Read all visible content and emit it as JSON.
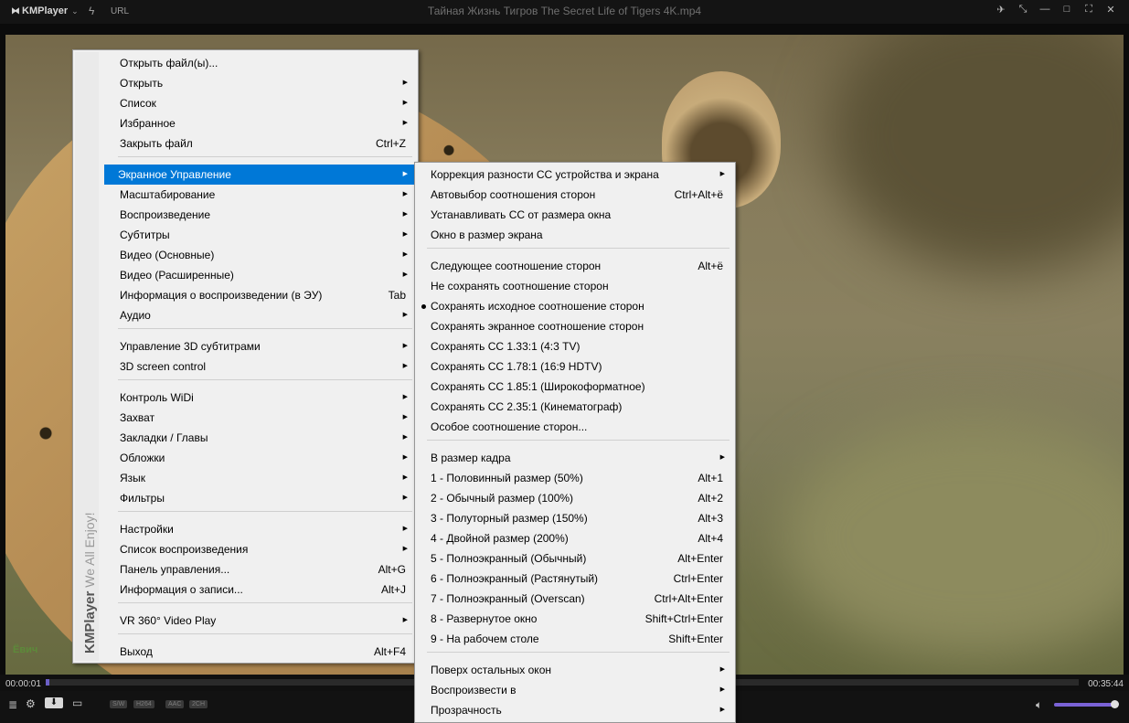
{
  "titlebar": {
    "brand": "KMPlayer",
    "url_label": "URL",
    "title": "Тайная Жизнь Тигров   The Secret Life of Tigers   4K.mp4"
  },
  "video": {
    "corner_text": "Ёвич"
  },
  "player": {
    "time_current": "00:00:01",
    "time_total": "00:35:44",
    "progress_fraction": 0.002,
    "volume_fraction": 0.95,
    "tags": [
      "S/W",
      "H264",
      "AAC",
      "2CH"
    ]
  },
  "main_menu": {
    "brand_strip": "KMPlayer",
    "brand_tagline": "We All Enjoy!",
    "items": [
      {
        "label": "Открыть файл(ы)...",
        "shortcut": "",
        "sub": false
      },
      {
        "label": "Открыть",
        "shortcut": "",
        "sub": true
      },
      {
        "label": "Список",
        "shortcut": "",
        "sub": true
      },
      {
        "label": "Избранное",
        "shortcut": "",
        "sub": true
      },
      {
        "label": "Закрыть файл",
        "shortcut": "Ctrl+Z",
        "sub": false
      },
      {
        "label": "Экранное Управление",
        "shortcut": "",
        "sub": true
      },
      {
        "label": "Масштабирование",
        "shortcut": "",
        "sub": true
      },
      {
        "label": "Воспроизведение",
        "shortcut": "",
        "sub": true
      },
      {
        "label": "Субтитры",
        "shortcut": "",
        "sub": true
      },
      {
        "label": "Видео (Основные)",
        "shortcut": "",
        "sub": true
      },
      {
        "label": "Видео (Расширенные)",
        "shortcut": "",
        "sub": true
      },
      {
        "label": "Информация о воспроизведении (в ЭУ)",
        "shortcut": "Tab",
        "sub": false
      },
      {
        "label": "Аудио",
        "shortcut": "",
        "sub": true
      },
      {
        "label": "Управление 3D субтитрами",
        "shortcut": "",
        "sub": true
      },
      {
        "label": "3D screen control",
        "shortcut": "",
        "sub": true
      },
      {
        "label": "Контроль WiDi",
        "shortcut": "",
        "sub": true
      },
      {
        "label": "Захват",
        "shortcut": "",
        "sub": true
      },
      {
        "label": "Закладки / Главы",
        "shortcut": "",
        "sub": true
      },
      {
        "label": "Обложки",
        "shortcut": "",
        "sub": true
      },
      {
        "label": "Язык",
        "shortcut": "",
        "sub": true
      },
      {
        "label": "Фильтры",
        "shortcut": "",
        "sub": true
      },
      {
        "label": "Настройки",
        "shortcut": "",
        "sub": true
      },
      {
        "label": "Список воспроизведения",
        "shortcut": "",
        "sub": true
      },
      {
        "label": "Панель управления...",
        "shortcut": "Alt+G",
        "sub": false
      },
      {
        "label": "Информация о записи...",
        "shortcut": "Alt+J",
        "sub": false
      },
      {
        "label": "VR 360° Video Play",
        "shortcut": "",
        "sub": true
      },
      {
        "label": "Выход",
        "shortcut": "Alt+F4",
        "sub": false
      }
    ]
  },
  "sub_menu": {
    "items": [
      {
        "label": "Коррекция разности СС устройства и экрана",
        "shortcut": "",
        "sub": true
      },
      {
        "label": "Автовыбор соотношения сторон",
        "shortcut": "Ctrl+Alt+ё",
        "sub": false
      },
      {
        "label": "Устанавливать СС от размера окна",
        "shortcut": "",
        "sub": false
      },
      {
        "label": "Окно в размер экрана",
        "shortcut": "",
        "sub": false
      },
      {
        "label": "Следующее соотношение сторон",
        "shortcut": "Alt+ё",
        "sub": false
      },
      {
        "label": "Не сохранять соотношение сторон",
        "shortcut": "",
        "sub": false
      },
      {
        "label": "Сохранять исходное соотношение сторон",
        "shortcut": "",
        "sub": false,
        "checked": true
      },
      {
        "label": "Сохранять экранное соотношение сторон",
        "shortcut": "",
        "sub": false
      },
      {
        "label": "Сохранять СС 1.33:1 (4:3 TV)",
        "shortcut": "",
        "sub": false
      },
      {
        "label": "Сохранять СС 1.78:1 (16:9 HDTV)",
        "shortcut": "",
        "sub": false
      },
      {
        "label": "Сохранять СС 1.85:1 (Широкоформатное)",
        "shortcut": "",
        "sub": false
      },
      {
        "label": "Сохранять СС 2.35:1 (Кинематограф)",
        "shortcut": "",
        "sub": false
      },
      {
        "label": "Особое соотношение сторон...",
        "shortcut": "",
        "sub": false
      },
      {
        "label": "В размер кадра",
        "shortcut": "",
        "sub": true
      },
      {
        "label": "1 - Половинный размер (50%)",
        "shortcut": "Alt+1",
        "sub": false
      },
      {
        "label": "2 - Обычный размер (100%)",
        "shortcut": "Alt+2",
        "sub": false
      },
      {
        "label": "3 - Полуторный размер (150%)",
        "shortcut": "Alt+3",
        "sub": false
      },
      {
        "label": "4 - Двойной размер (200%)",
        "shortcut": "Alt+4",
        "sub": false
      },
      {
        "label": "5 - Полноэкранный (Обычный)",
        "shortcut": "Alt+Enter",
        "sub": false
      },
      {
        "label": "6 - Полноэкранный (Растянутый)",
        "shortcut": "Ctrl+Enter",
        "sub": false
      },
      {
        "label": "7 - Полноэкранный (Overscan)",
        "shortcut": "Ctrl+Alt+Enter",
        "sub": false
      },
      {
        "label": "8 - Развернутое окно",
        "shortcut": "Shift+Ctrl+Enter",
        "sub": false
      },
      {
        "label": "9 - На рабочем столе",
        "shortcut": "Shift+Enter",
        "sub": false
      },
      {
        "label": "Поверх остальных окон",
        "shortcut": "",
        "sub": true
      },
      {
        "label": "Воспроизвести в",
        "shortcut": "",
        "sub": true
      },
      {
        "label": "Прозрачность",
        "shortcut": "",
        "sub": true
      }
    ]
  },
  "colors": {
    "highlight": "#0078d7",
    "accent": "#6b5fc6"
  }
}
